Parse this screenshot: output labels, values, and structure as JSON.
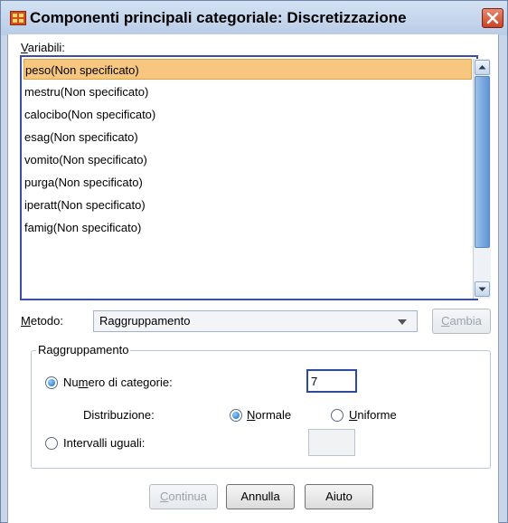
{
  "window": {
    "title": "Componenti principali categoriale: Discretizzazione"
  },
  "variables": {
    "label": "Variabili:",
    "items": [
      {
        "label": "peso(Non specificato)",
        "selected": true
      },
      {
        "label": "mestru(Non specificato)",
        "selected": false
      },
      {
        "label": "calocibo(Non specificato)",
        "selected": false
      },
      {
        "label": "esag(Non specificato)",
        "selected": false
      },
      {
        "label": "vomito(Non specificato)",
        "selected": false
      },
      {
        "label": "purga(Non specificato)",
        "selected": false
      },
      {
        "label": "iperatt(Non specificato)",
        "selected": false
      },
      {
        "label": "famig(Non specificato)",
        "selected": false
      }
    ]
  },
  "method": {
    "label": "Metodo:",
    "value": "Raggruppamento",
    "change_button": "Cambia"
  },
  "grouping": {
    "title": "Raggruppamento",
    "num_categories_label": "Numero di categorie:",
    "num_categories_value": "7",
    "distribution_label": "Distribuzione:",
    "normal_label": "Normale",
    "uniform_label": "Uniforme",
    "equal_intervals_label": "Intervalli uguali:",
    "equal_intervals_value": ""
  },
  "buttons": {
    "continue": "Continua",
    "cancel": "Annulla",
    "help": "Aiuto"
  },
  "colors": {
    "selection": "#f7c77f",
    "list_border": "#3a4fa3",
    "title_bar": "#c9d6ea"
  }
}
